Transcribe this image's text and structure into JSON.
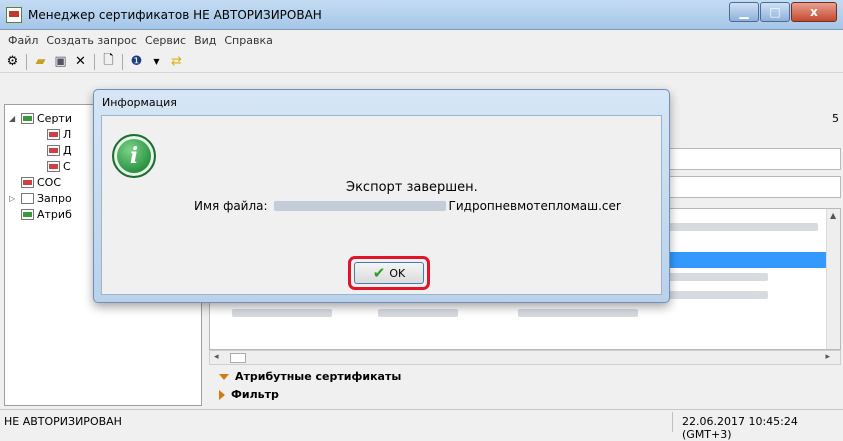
{
  "window": {
    "title": "Менеджер сертификатов  НЕ АВТОРИЗИРОВАН",
    "minimize": "▁",
    "maximize": "□",
    "close": "x"
  },
  "menu": [
    "Файл",
    "Создать запрос",
    "Сервис",
    "Вид",
    "Справка"
  ],
  "toolbar_icons": [
    "settings-icon",
    "open-icon",
    "import-icon",
    "delete-icon",
    "document-icon",
    "info-icon",
    "refresh-icon"
  ],
  "tree": {
    "items": [
      {
        "label": "Серти",
        "expander": "◢"
      },
      {
        "label": "Л"
      },
      {
        "label": "Д"
      },
      {
        "label": "С"
      },
      {
        "label": "СОС"
      },
      {
        "label": "Запро",
        "expander": "▷"
      },
      {
        "label": "Атриб"
      }
    ]
  },
  "right_panel": {
    "count": "5",
    "sections": {
      "attr_certs": "Атрибутные сертификаты",
      "filter": "Фильтр"
    }
  },
  "status": {
    "left": "НЕ АВТОРИЗИРОВАН",
    "right": "22.06.2017 10:45:24 (GMT+3)"
  },
  "dialog": {
    "title": "Информация",
    "icon_letter": "i",
    "message": "Экспорт завершен.",
    "file_label": "Имя файла:",
    "file_name": "Гидропневмотепломаш.cer",
    "ok": "OK",
    "highlight_color": "#e0152a"
  }
}
